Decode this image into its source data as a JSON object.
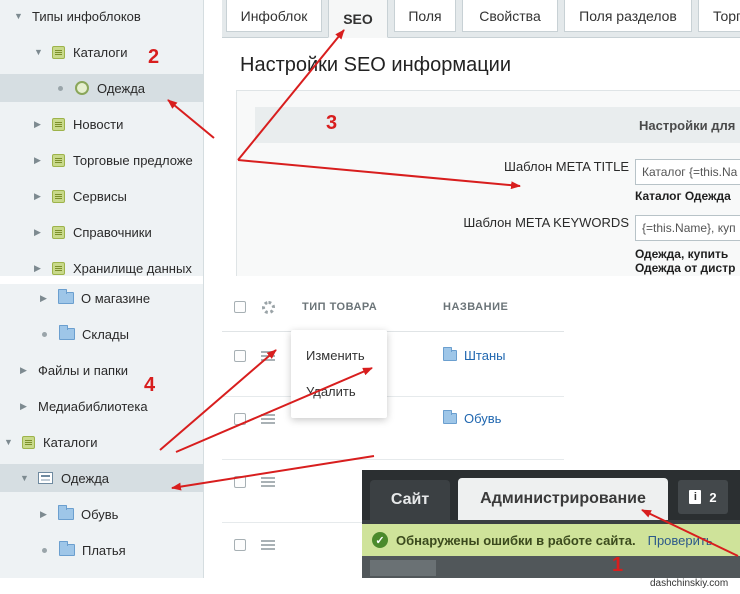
{
  "sidebar": {
    "items": [
      {
        "label": "Типы инфоблоков"
      },
      {
        "label": "Каталоги"
      },
      {
        "label": "Одежда"
      },
      {
        "label": "Новости"
      },
      {
        "label": "Торговые предложе"
      },
      {
        "label": "Сервисы"
      },
      {
        "label": "Справочники"
      },
      {
        "label": "Хранилище данных"
      },
      {
        "label": "О магазине"
      },
      {
        "label": "Склады"
      },
      {
        "label": "Файлы и папки"
      },
      {
        "label": "Медиабиблиотека"
      },
      {
        "label": "Каталоги"
      },
      {
        "label": "Одежда"
      },
      {
        "label": "Обувь"
      },
      {
        "label": "Платья"
      }
    ]
  },
  "seo": {
    "tabs": [
      "Инфоблок",
      "SEO",
      "Поля",
      "Свойства",
      "Поля разделов",
      "Торг"
    ],
    "title": "Настройки SEO информации",
    "section_header": "Настройки для",
    "fields": [
      {
        "label": "Шаблон META TITLE",
        "value": "Каталог {=this.Na",
        "preview": "Каталог Одежда"
      },
      {
        "label": "Шаблон META KEYWORDS",
        "value": "{=this.Name}, куп",
        "preview": "Одежда, купить",
        "preview2": "Одежда от дистр"
      }
    ]
  },
  "grid": {
    "columns": [
      "ТИП ТОВАРА",
      "НАЗВАНИЕ"
    ],
    "rows": [
      {
        "name": "Штаны"
      },
      {
        "name": "Обувь"
      }
    ],
    "context_menu": [
      "Изменить",
      "Удалить"
    ]
  },
  "admin_bar": {
    "site_tab": "Сайт",
    "admin_tab": "Администрирование",
    "notif_count": "2",
    "notif_icon_glyph": "i",
    "alert_text": "Обнаружены ошибки в работе сайта.",
    "alert_link": "Проверить"
  },
  "annotations": {
    "steps": [
      "1",
      "2",
      "3",
      "4"
    ],
    "color": "#d81e1e"
  },
  "watermark": "dashchinskiy.com"
}
